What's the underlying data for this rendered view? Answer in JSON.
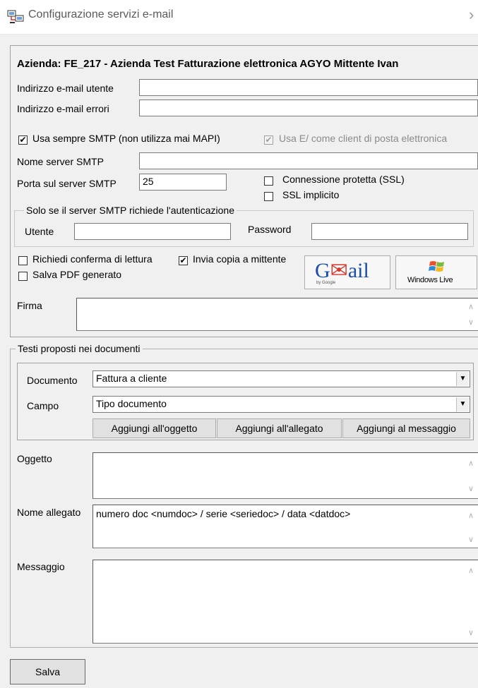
{
  "window": {
    "title": "Configurazione servizi e-mail",
    "app_icon": "computer-network-icon",
    "chevron": "›"
  },
  "account": {
    "header": "Azienda: FE_217 - Azienda Test Fatturazione elettronica AGYO Mittente Ivan",
    "user_email_label": "Indirizzo e-mail utente",
    "user_email_value": "",
    "error_email_label": "Indirizzo e-mail errori",
    "error_email_value": ""
  },
  "smtp": {
    "always_smtp_label": "Usa sempre SMTP (non utilizza mai MAPI)",
    "always_smtp_checked": true,
    "use_client_label": "Usa E/ come client di posta elettronica",
    "use_client_checked": true,
    "server_label": "Nome server SMTP",
    "server_value": "",
    "port_label": "Porta sul server SMTP",
    "port_value": "25",
    "ssl_label": "Connessione protetta (SSL)",
    "ssl_checked": false,
    "implicit_ssl_label": "SSL implicito",
    "implicit_ssl_checked": false
  },
  "auth": {
    "legend": "Solo se il server SMTP richiede l'autenticazione",
    "user_label": "Utente",
    "user_value": "",
    "password_label": "Password",
    "password_value": ""
  },
  "options": {
    "read_receipt_label": "Richiedi conferma di lettura",
    "read_receipt_checked": false,
    "copy_sender_label": "Invia copia a mittente",
    "copy_sender_checked": true,
    "save_pdf_label": "Salva PDF generato",
    "save_pdf_checked": false,
    "gmail_logo_text": "Gmail",
    "gmail_by": "by Google",
    "windows_live_text": "Windows Live"
  },
  "signature": {
    "label": "Firma",
    "value": ""
  },
  "texts": {
    "legend": "Testi proposti nei documenti",
    "document_label": "Documento",
    "document_value": "Fattura a cliente",
    "field_label": "Campo",
    "field_value": "Tipo documento",
    "add_subject_button": "Aggiungi all'oggetto",
    "add_attachment_button": "Aggiungi all'allegato",
    "add_message_button": "Aggiungi al messaggio"
  },
  "subject": {
    "label": "Oggetto",
    "value": ""
  },
  "attachment_name": {
    "label": "Nome allegato",
    "value": "numero doc <numdoc> / serie <seriedoc> / data <datdoc>"
  },
  "message": {
    "label": "Messaggio",
    "value": ""
  },
  "footer": {
    "save_button": "Salva"
  },
  "check_mark": "✔",
  "scroll_up": "∧",
  "scroll_down": "∨",
  "dropdown_arrow": "▼"
}
